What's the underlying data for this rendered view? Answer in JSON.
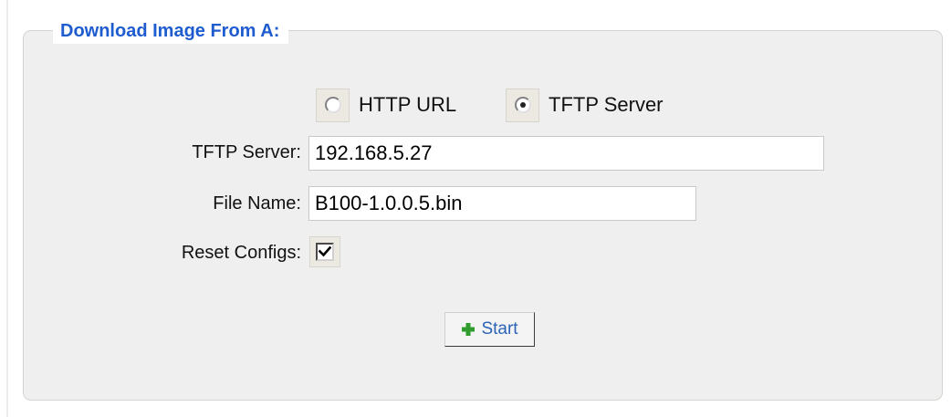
{
  "section": {
    "title": "Download Image From A:"
  },
  "source": {
    "options": [
      {
        "label": "HTTP URL",
        "selected": false
      },
      {
        "label": "TFTP Server",
        "selected": true
      }
    ]
  },
  "fields": {
    "server": {
      "label": "TFTP Server:",
      "value": "192.168.5.27"
    },
    "file": {
      "label": "File Name:",
      "value": "B100-1.0.0.5.bin"
    },
    "reset": {
      "label": "Reset Configs:",
      "checked": true
    }
  },
  "actions": {
    "start_label": "Start",
    "start_icon": "plus-icon"
  },
  "colors": {
    "title": "#1e5ccf",
    "panel_bg": "#efefef",
    "start_text": "#2c63b7",
    "start_icon": "#2e9d2e"
  }
}
